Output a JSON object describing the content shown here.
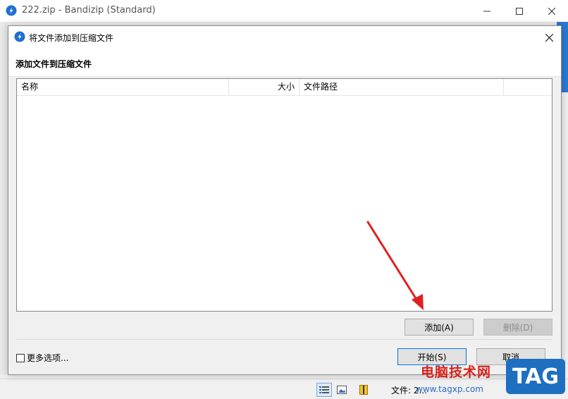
{
  "main_window": {
    "title": "222.zip - Bandizip (Standard)",
    "status": "文件: 2..."
  },
  "dialog": {
    "title": "将文件添加到压缩文件",
    "heading": "添加文件到压缩文件",
    "columns": {
      "name": "名称",
      "size": "大小",
      "path": "文件路径",
      "extra": ""
    },
    "rows": [],
    "add_button": "添加(A)",
    "delete_button": "删除(D)",
    "more_options": "更多选项...",
    "start_button": "开始(S)",
    "cancel_button": "取消"
  },
  "watermark": {
    "text": "电脑技术网",
    "url": "www.tagxp.com",
    "logo": "TAG"
  },
  "colors": {
    "accent": "#0078d7",
    "arrow": "#e02020",
    "tag_logo": "#1f6fc0"
  }
}
